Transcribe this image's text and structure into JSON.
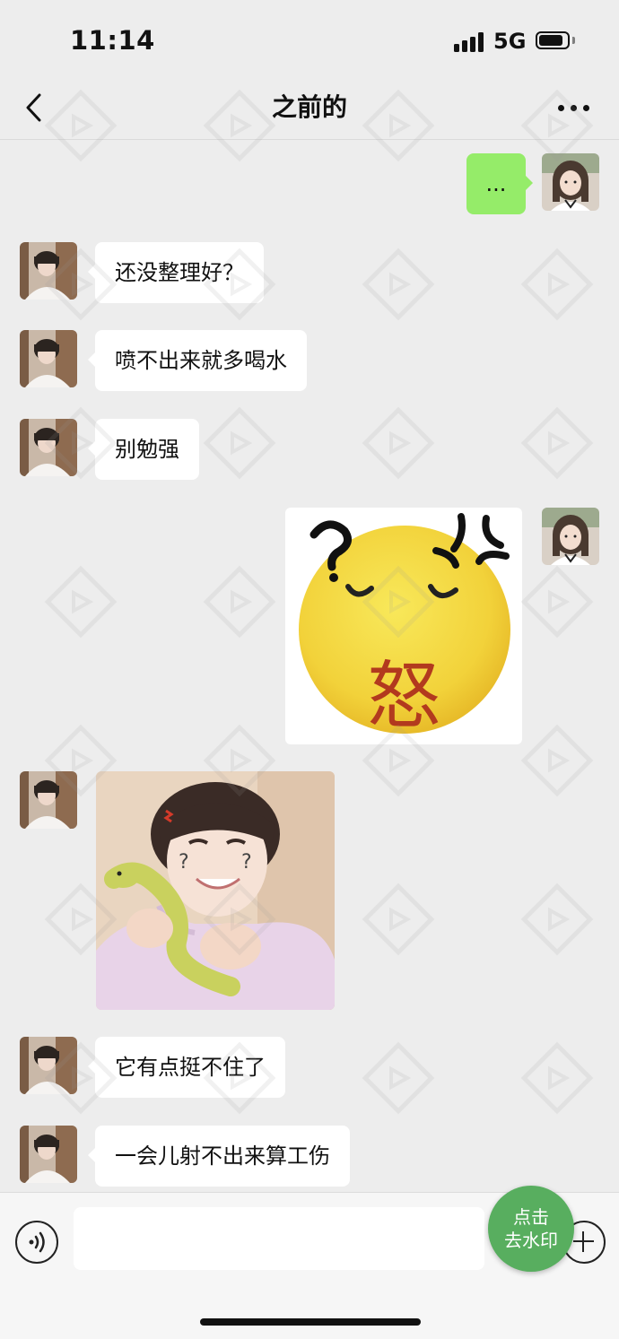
{
  "status_bar": {
    "time": "11:14",
    "network": "5G",
    "signal_bars": 4,
    "battery_level": 0.85
  },
  "nav": {
    "title": "之前的",
    "back_icon": "chevron-left-icon",
    "more_icon": "more-dots-icon"
  },
  "messages": [
    {
      "id": 1,
      "side": "out",
      "type": "text",
      "text": "..."
    },
    {
      "id": 2,
      "side": "in",
      "type": "text",
      "text": "还没整理好？"
    },
    {
      "id": 3,
      "side": "in",
      "type": "text",
      "text": "喷不出来就多喝水"
    },
    {
      "id": 4,
      "side": "in",
      "type": "text",
      "text": "别勉强"
    },
    {
      "id": 5,
      "side": "out",
      "type": "sticker",
      "caption": "怒",
      "description": "angry-emoji-sticker"
    },
    {
      "id": 6,
      "side": "in",
      "type": "sticker",
      "description": "boy-with-toy-snake-photo"
    },
    {
      "id": 7,
      "side": "in",
      "type": "text",
      "text": "它有点挺不住了"
    },
    {
      "id": 8,
      "side": "in",
      "type": "text",
      "text": "一会儿射不出来算工伤"
    }
  ],
  "input_bar": {
    "placeholder": "",
    "voice_icon": "voice-icon",
    "plus_icon": "plus-icon"
  },
  "watermark_button": {
    "line1": "点击",
    "line2": "去水印"
  },
  "colors": {
    "background": "#EDEDED",
    "outgoing_bubble": "#95EC69",
    "incoming_bubble": "#FFFFFF",
    "watermark_button": "#58AE5F"
  }
}
